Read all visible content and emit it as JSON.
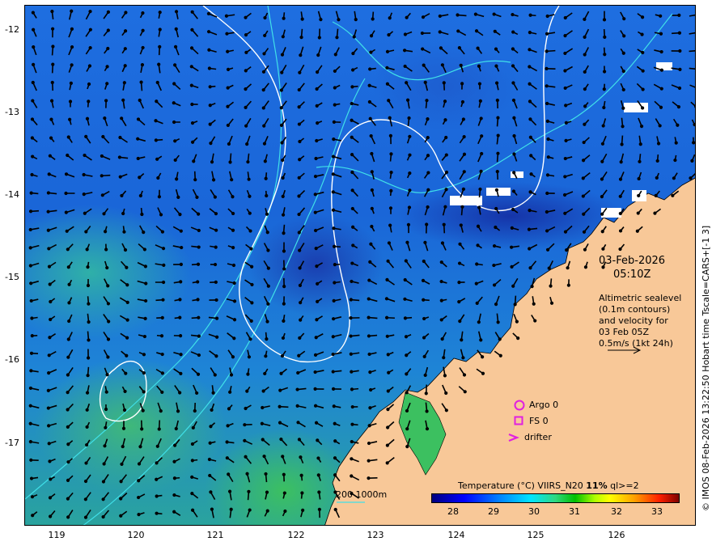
{
  "map": {
    "date": "03-Feb-2026",
    "time": "05:10Z",
    "description_lines": [
      "Altimetric sealevel",
      "(0.1m contours)",
      "and velocity for",
      "03 Feb 05Z",
      "0.5m/s (1kt 24h)"
    ],
    "legend": {
      "argo": "Argo 0",
      "fs": "FS 0",
      "drifter": "drifter"
    },
    "depth_label": "200  1000m",
    "colorbar_title_pre": "Temperature (°C) VIIRS_N20 ",
    "colorbar_title_bold": "11%",
    "colorbar_title_post": " ql>=2",
    "colorbar_ticks": [
      "28",
      "29",
      "30",
      "31",
      "32",
      "33"
    ],
    "copyright": "© IMOS 08-Feb-2026 13:22:50 Hobart time Tscale=CARS+[-1 3]",
    "x_ticks": [
      "119",
      "120",
      "121",
      "122",
      "123",
      "124",
      "125",
      "126"
    ],
    "y_ticks": [
      "-12",
      "-13",
      "-14",
      "-15",
      "-16",
      "-17"
    ],
    "colors": {
      "land": "#f8c898",
      "sealevel_contour": "#ffffff",
      "depth_contour": "#40e0e8",
      "marker": "#e020e0",
      "arrow": "#000000"
    }
  }
}
